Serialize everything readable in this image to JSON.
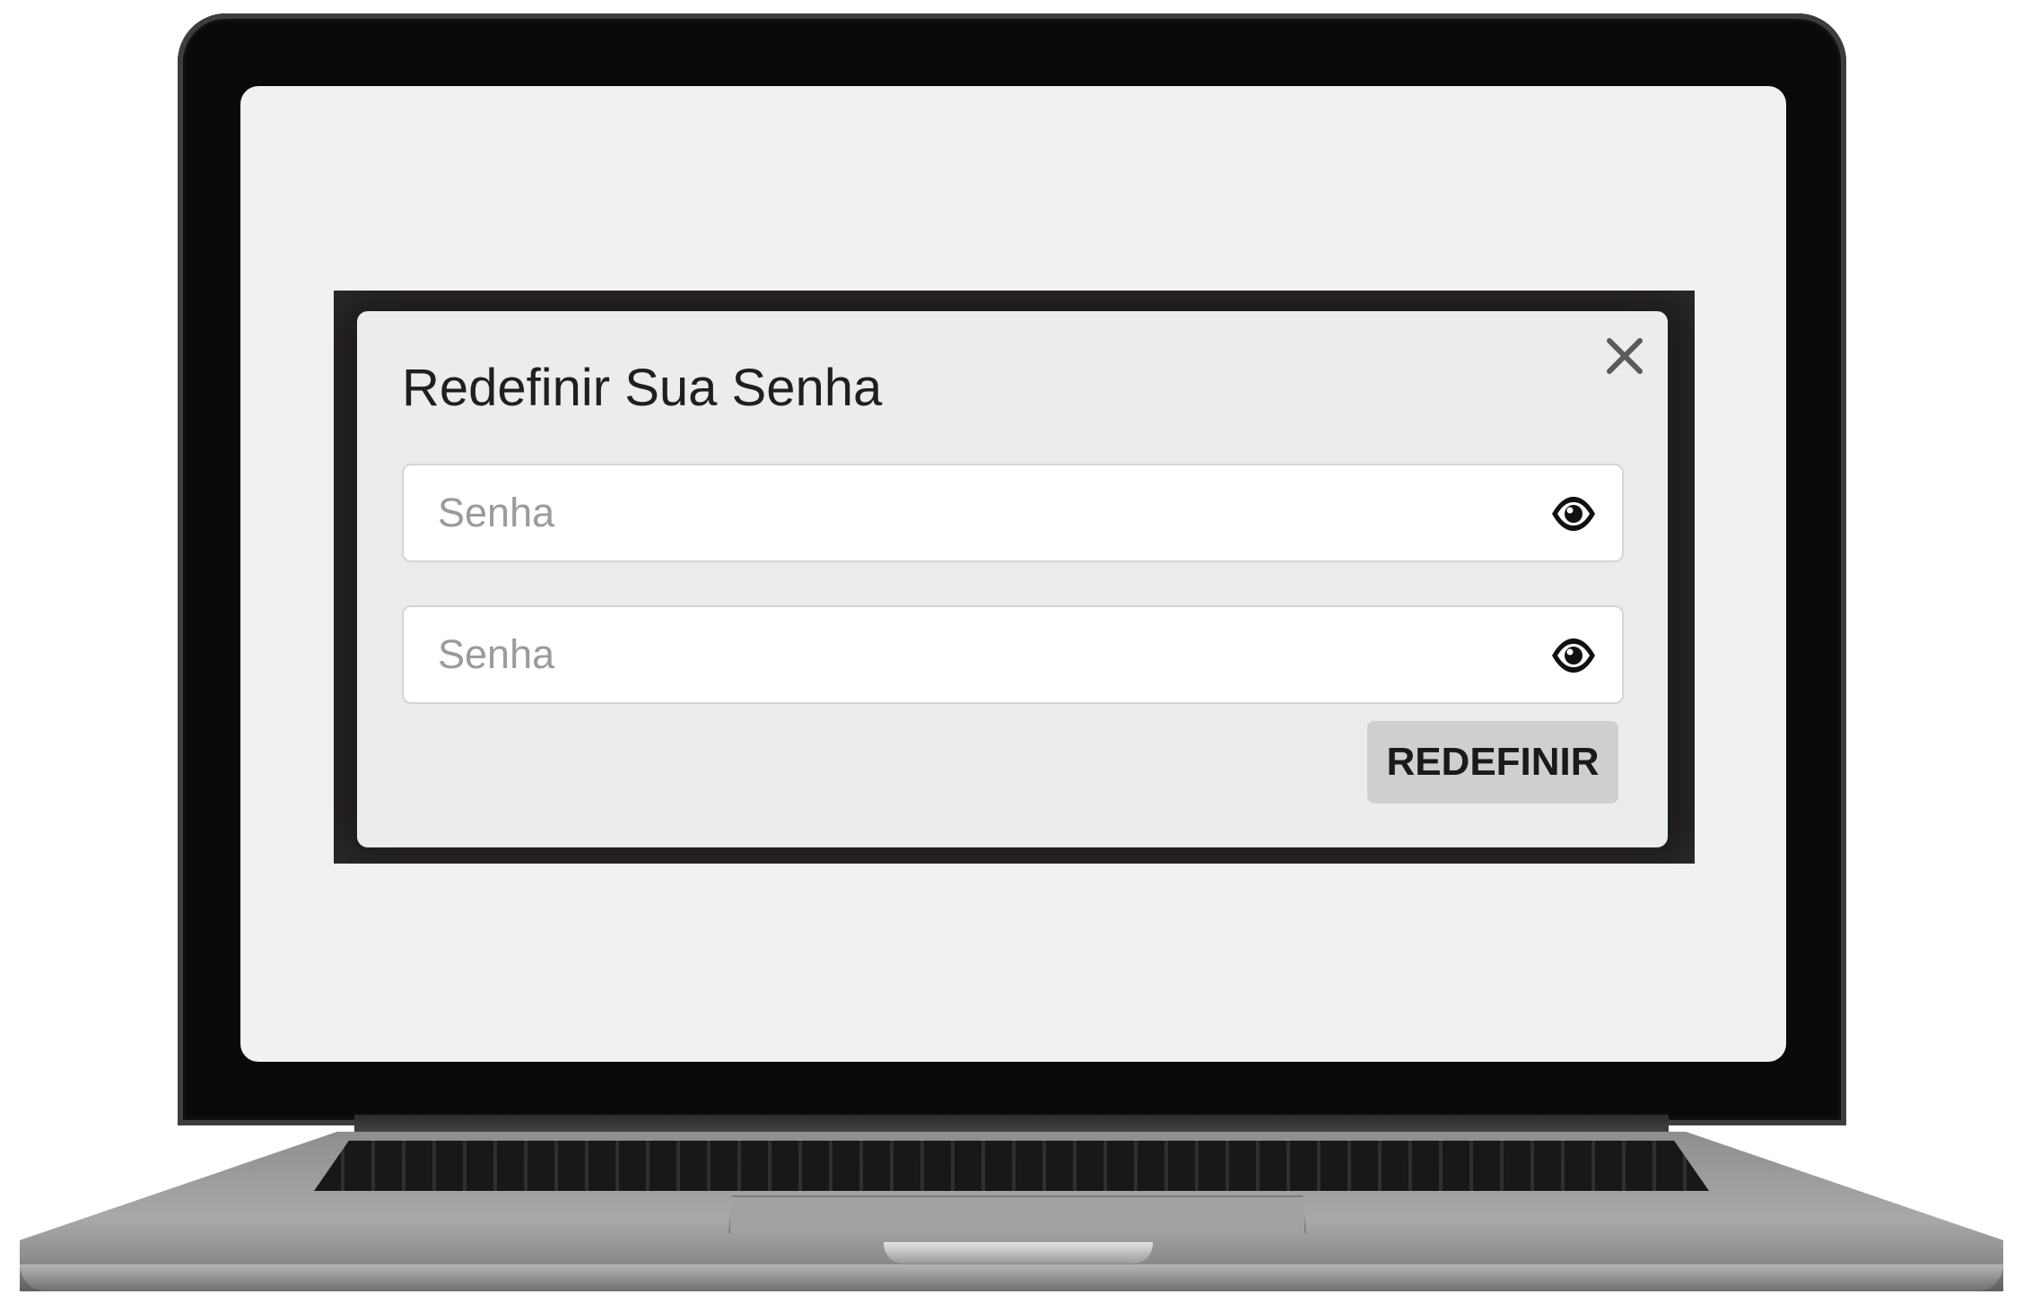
{
  "modal": {
    "title": "Redefinir Sua Senha",
    "close_icon": "close-icon",
    "password_field": {
      "placeholder": "Senha",
      "value": "",
      "toggle_icon": "eye-icon"
    },
    "confirm_password_field": {
      "placeholder": "Senha",
      "value": "",
      "toggle_icon": "eye-icon"
    },
    "submit_label": "REDEFINIR"
  },
  "colors": {
    "screen_background": "#f1f1f1",
    "modal_background": "#ececec",
    "modal_frame": "#1b1817",
    "button_background": "#cfcfcf",
    "title_text": "#1f1f1f",
    "placeholder_text": "#9b9b9b"
  }
}
